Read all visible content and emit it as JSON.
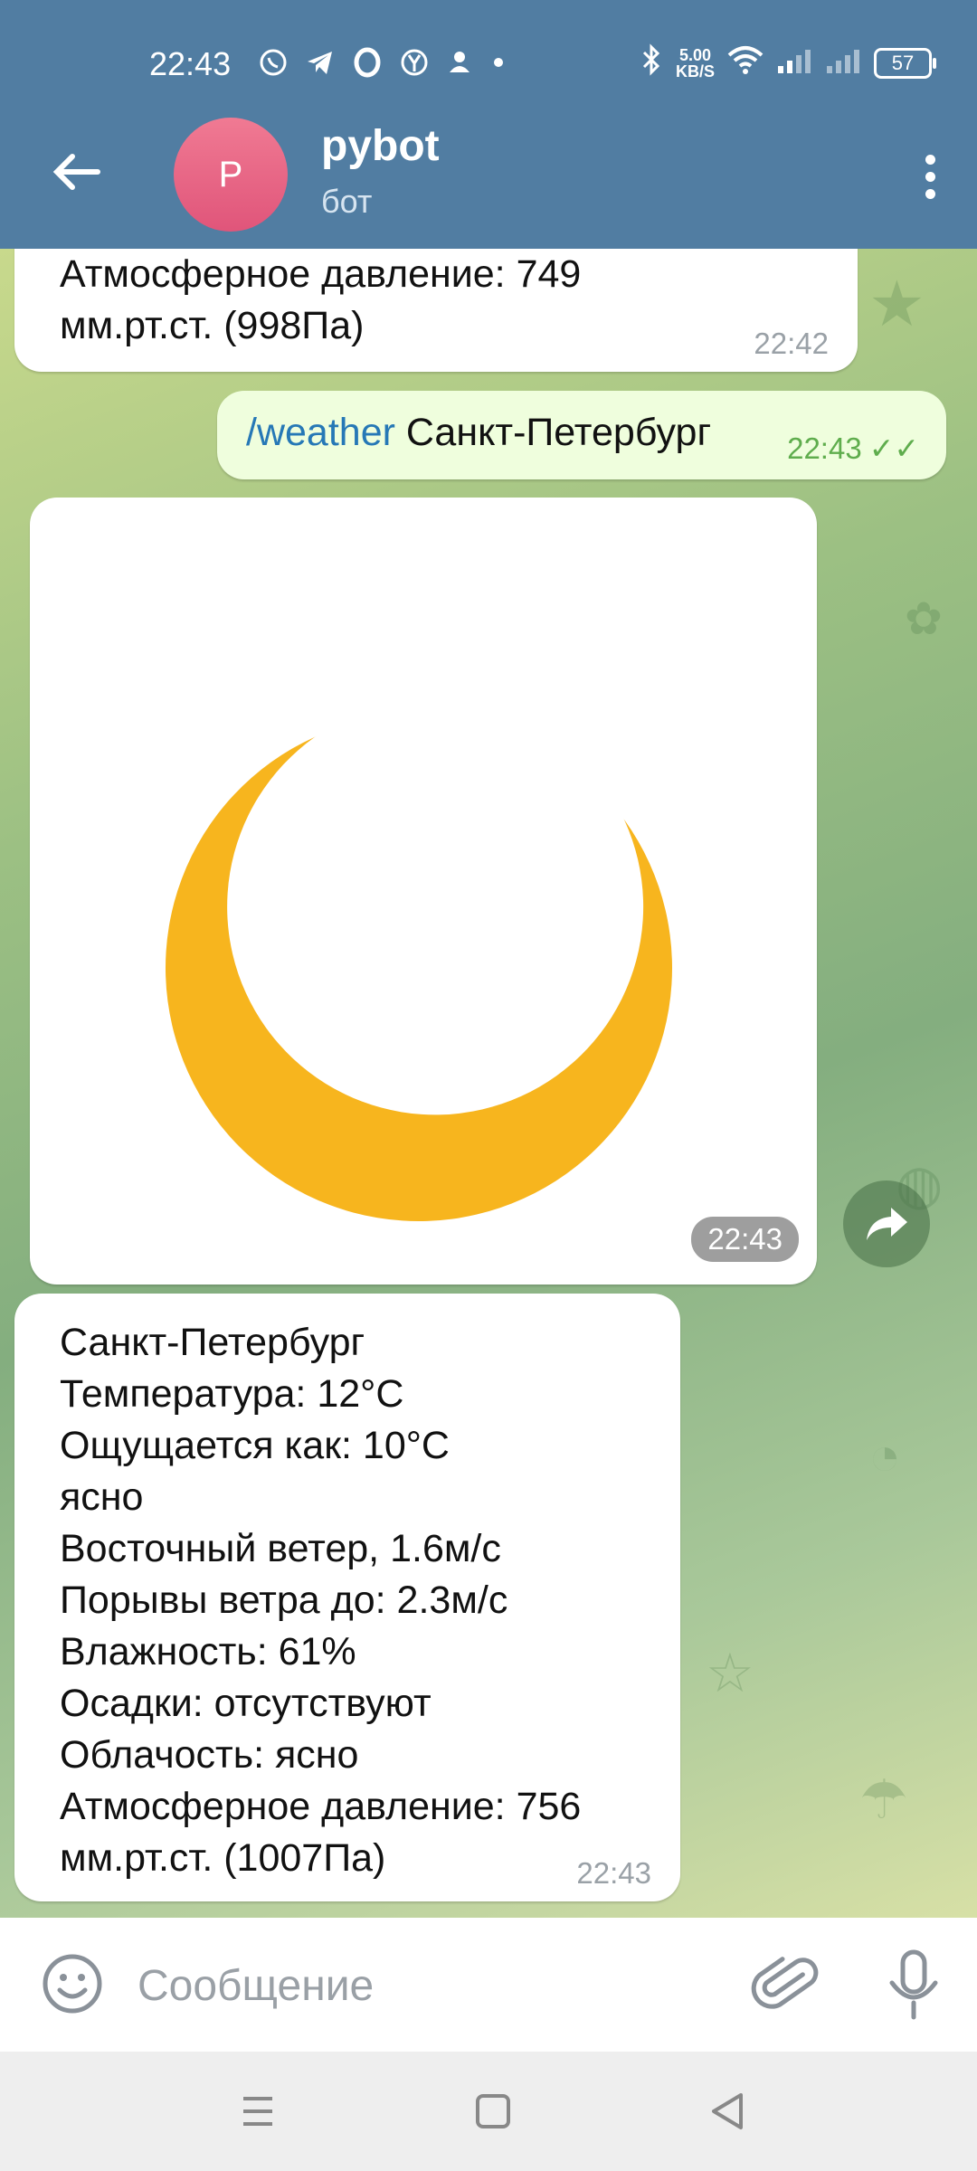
{
  "status_bar": {
    "time": "22:43",
    "speed_value": "5.00",
    "speed_unit": "KB/S",
    "battery": "57",
    "icons": [
      "viber-icon",
      "telegram-icon",
      "opera-icon",
      "yandex-icon",
      "person-icon",
      "dot-icon",
      "bluetooth-icon",
      "wifi-icon",
      "signal-icon",
      "signal-icon-2",
      "battery-icon"
    ]
  },
  "header": {
    "avatar_letter": "P",
    "chat_name": "pybot",
    "chat_status": "бот",
    "colors": {
      "bar": "#517da2",
      "avatar": "#e9647f"
    }
  },
  "messages": {
    "prev_bot": {
      "text": "Атмосферное давление: 749\nмм.рт.ст. (998Па)",
      "time": "22:42"
    },
    "user": {
      "command": "/weather",
      "text": " Санкт-Петербург",
      "time": "22:43"
    },
    "photo": {
      "description_icon": "crescent-moon-icon",
      "time": "22:43"
    },
    "bot_weather": {
      "text": "Санкт-Петербург\nТемпература: 12°C\nОщущается как: 10°C\nясно\nВосточный ветер, 1.6м/с\nПорывы ветра до: 2.3м/с\nВлажность: 61%\nОсадки: отсутствуют\nОблачость: ясно\nАтмосферное давление: 756\nмм.рт.ст. (1007Па)",
      "time": "22:43"
    }
  },
  "input": {
    "placeholder": "Сообщение",
    "value": ""
  },
  "colors": {
    "incoming_bubble": "#ffffff",
    "outgoing_bubble": "#effedd",
    "command_link": "#2678b6",
    "read_ticks": "#5fad4d",
    "moon": "#f7b51e"
  }
}
